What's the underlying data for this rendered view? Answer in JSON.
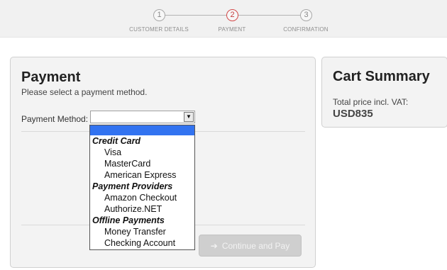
{
  "stepper": {
    "steps": [
      {
        "number": "1",
        "label": "CUSTOMER DETAILS"
      },
      {
        "number": "2",
        "label": "PAYMENT"
      },
      {
        "number": "3",
        "label": "CONFIRMATION"
      }
    ],
    "active_step": 2,
    "active_color": "#d34a4a"
  },
  "payment": {
    "title": "Payment",
    "subtitle": "Please select a payment method.",
    "method_label": "Payment Method:",
    "method_value": "",
    "continue_label": "Continue and Pay",
    "continue_icon": "arrow-right-icon"
  },
  "dropdown": {
    "groups": [
      {
        "label": "Credit Card",
        "options": [
          "Visa",
          "MasterCard",
          "American Express"
        ]
      },
      {
        "label": "Payment Providers",
        "options": [
          "Amazon Checkout",
          "Authorize.NET"
        ]
      },
      {
        "label": "Offline Payments",
        "options": [
          "Money Transfer",
          "Checking Account"
        ]
      }
    ],
    "highlight_color": "#3273f0"
  },
  "cart": {
    "title": "Cart Summary",
    "total_label": "Total price incl. VAT:",
    "total_value": "USD835"
  }
}
